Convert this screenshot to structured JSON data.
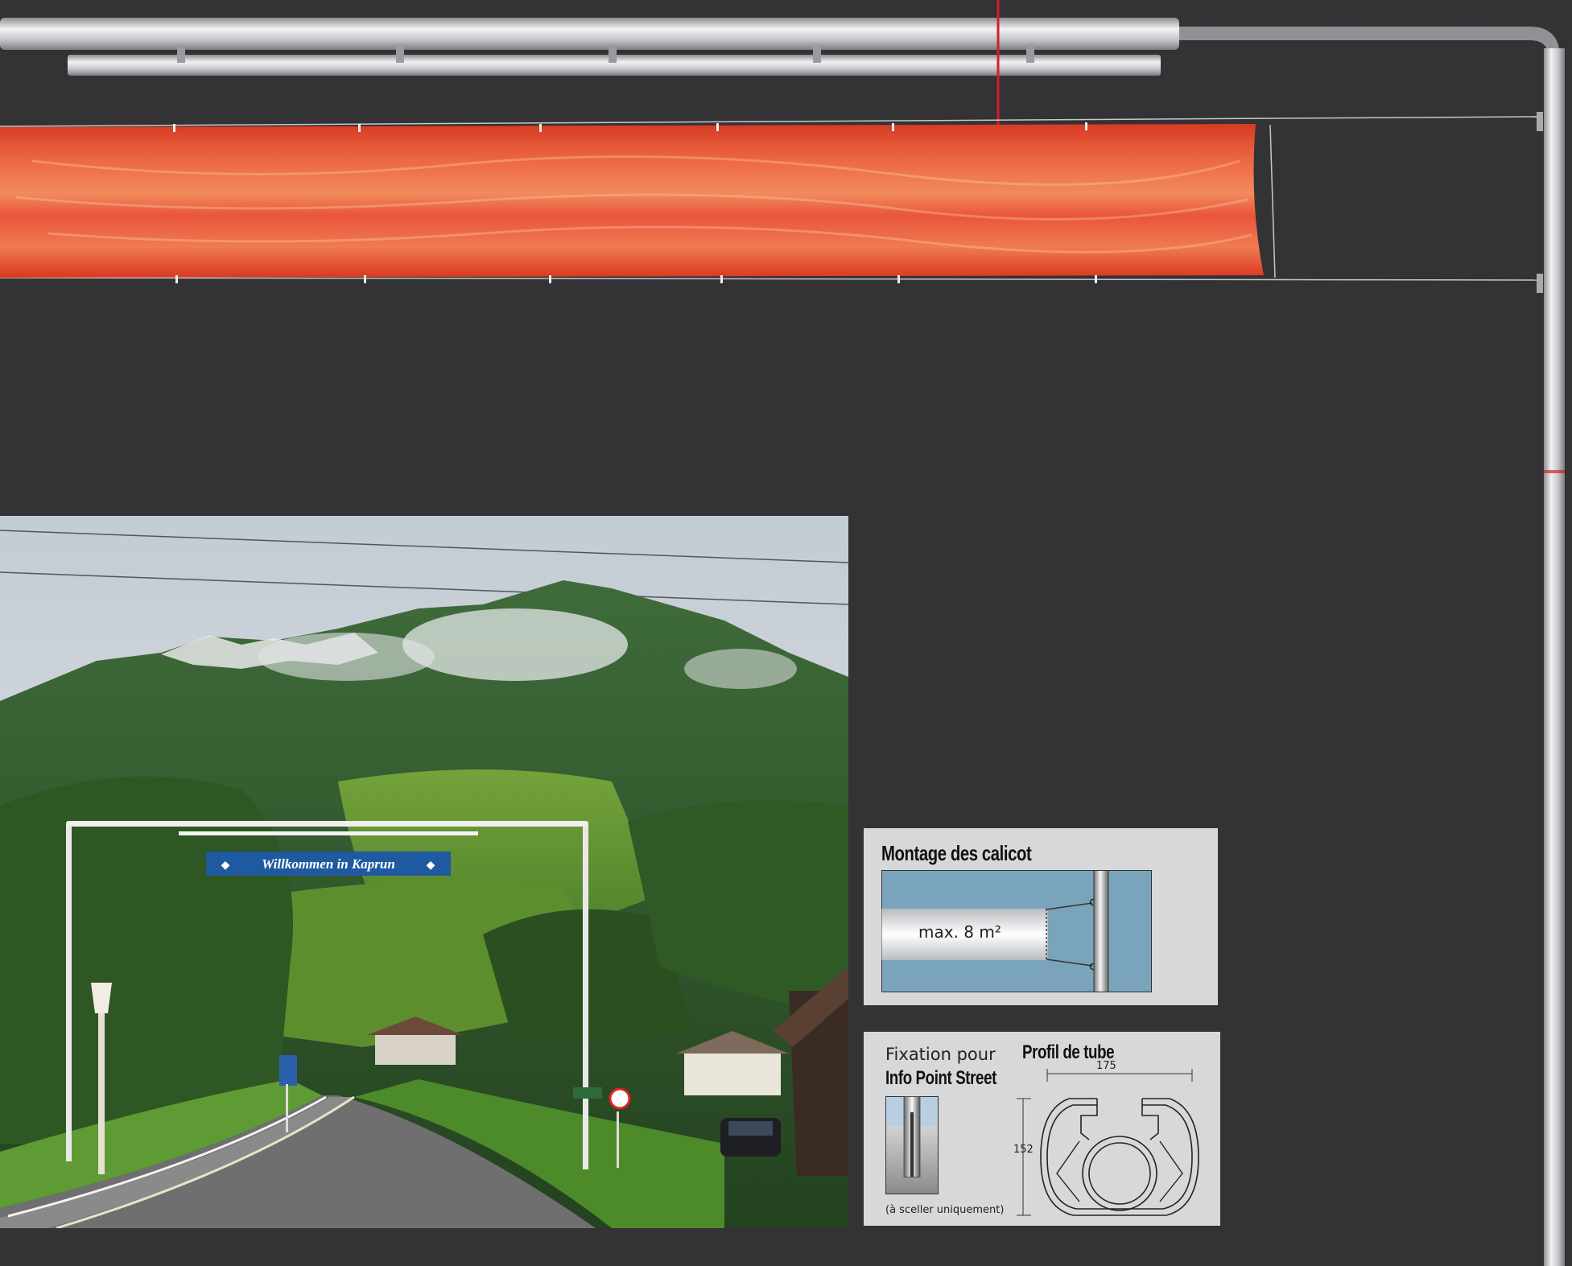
{
  "colors": {
    "background": "#333234",
    "banner_red": "#e2432a",
    "tube_silver": "#c9cacc",
    "panel_grey": "#d7d8da",
    "diagram_blue": "#7aa4bb",
    "sign_blue": "#1f5aa0"
  },
  "photo": {
    "banner_text": "Willkommen in Kaprun"
  },
  "montage": {
    "title": "Montage des calicot",
    "label": "max. 8 m²"
  },
  "fixation": {
    "title_line1": "Fixation pour",
    "title_line2": "Info Point Street",
    "note": "(à sceller uniquement)"
  },
  "profil": {
    "title": "Profil de tube",
    "width_label": "175",
    "height_label": "152"
  }
}
